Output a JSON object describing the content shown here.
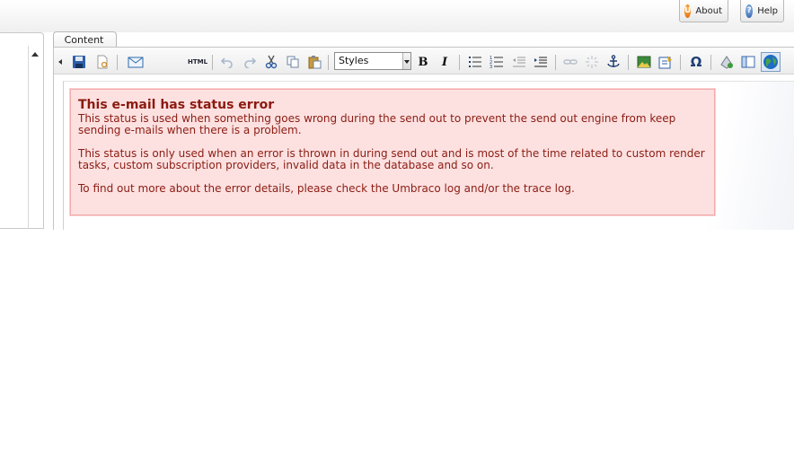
{
  "header": {
    "about_label": "About",
    "help_label": "Help",
    "about_icon": "umbraco-logo-icon",
    "help_icon": "question-icon"
  },
  "tabs": [
    {
      "label": "Content"
    }
  ],
  "toolbar": {
    "html_label": "HTML",
    "styles_value": "Styles",
    "bold_label": "B",
    "italic_label": "I",
    "omega_label": "Ω"
  },
  "status": {
    "title": "This e-mail has status error",
    "paragraphs": [
      "This status is used when something goes wrong during the send out to prevent the send out engine from keep sending e-mails when there is a problem.",
      "This status is only used when an error is thrown in during send out and is most of the time related to custom render tasks, custom subscription providers, invalid data in the database and so on.",
      "To find out more about the error details, please check the Umbraco log and/or the trace log."
    ]
  },
  "colors": {
    "status_bg": "#fde1e1",
    "status_border": "#f4a9a9",
    "status_text": "#8b1c12"
  }
}
